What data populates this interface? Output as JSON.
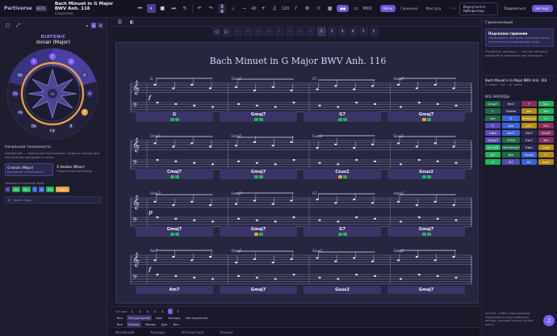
{
  "app": {
    "brand": "Partiverse",
    "brand_tag": "BETA",
    "title": "Bach Minuet in G Major BWV Anh. 116",
    "subtitle": "Сохранено"
  },
  "transport": {
    "tempo_top": "3",
    "tempo_bottom": "4",
    "bpm": "120",
    "metronome_value": "40",
    "mode_label": "MIDI"
  },
  "header_tabs": [
    "Ноты",
    "Гармония",
    "Фактура"
  ],
  "header_right": {
    "library": "Вернуться в библиотеку",
    "share": "Поделиться",
    "export": "Экспорт"
  },
  "left": {
    "diatonic_label": "DIATONIC",
    "mode_name": "Ionian (Major)",
    "circle_notes": [
      "C",
      "G",
      "D",
      "A",
      "E",
      "B",
      "F#",
      "Db",
      "Ab",
      "Eb",
      "Bb",
      "F"
    ],
    "mini": [
      "a",
      "b",
      "B"
    ],
    "section_title": "Начальная тональность",
    "hint": "Ионийский — самый светлый вариант ладов и основа для построения аккордов в песне.",
    "opt1_t": "G Ionian (Major)",
    "opt1_s": "Исходная тональность",
    "opt2_t": "E Aeolian (Minor)",
    "opt2_s": "Параллельный минор",
    "chords_label": "Аккорды ступеней лада",
    "scale_chips": [
      "G",
      "Am",
      "Bm",
      "C",
      "D",
      "Em",
      "F#dim"
    ],
    "search_ph": "Поиск ладу..."
  },
  "toolbar": {
    "items": [
      "1",
      "2",
      "3",
      "4"
    ],
    "pages": [
      "1",
      "2"
    ]
  },
  "score": {
    "title": "Bach Minuet in G Major BWV Anh. 116",
    "systems": [
      {
        "chords_above": [
          "G",
          "Gmaj7",
          "G7",
          "Gmaj7"
        ],
        "dyn": "f",
        "blocks": [
          "G",
          "Gmaj7",
          "G7",
          "Gmaj7"
        ]
      },
      {
        "chords_above": [
          "Cmaj7",
          "Gmaj7",
          "Csus2",
          "Gsus2"
        ],
        "dyn": "",
        "blocks": [
          "Cmaj7",
          "Gmaj7",
          "Csus2",
          "Gsus2"
        ]
      },
      {
        "chords_above": [
          "Gmaj7",
          "Gmaj7",
          "G7",
          "Gmaj7"
        ],
        "dyn": "p",
        "blocks": [
          "Gmaj7",
          "Gmaj7",
          "G7",
          "Gmaj7"
        ]
      },
      {
        "chords_above": [
          "Am7",
          "Gmaj7",
          "Gsus2",
          "Gmaj7"
        ],
        "dyn": "f",
        "blocks": [
          "Am7",
          "Gmaj7",
          "Gsus2",
          "Gmaj7"
        ]
      }
    ]
  },
  "bottom": {
    "row1_label": "Октава",
    "row1": [
      "1",
      "2",
      "3",
      "4",
      "5",
      "6",
      "7"
    ],
    "row2": [
      "Все",
      "Натуральный",
      "Шаг",
      "Аккорд",
      "Инструменты"
    ],
    "row3": [
      "Все",
      "Мажор",
      "Минор",
      "Доп",
      "Все"
    ],
    "row4_label": "Аккорды в:",
    "row4": [
      "G",
      "Ki",
      "Cc"
    ],
    "status": [
      "Ионийский",
      "Аккорды",
      "Аппликатура",
      "Хорошо"
    ]
  },
  "right": {
    "section1": "Гармонизация",
    "card_title": "Подсказка гармонии",
    "card_text": "Подбирайте аккорды, которые звучат естественно в выбранном ладу.",
    "note1": "Подобные аккорды — частые находки",
    "note2": "выбирайте гармонию под мелодию",
    "piece_title": "Bach Minuet in G Major BWV Anh. 116",
    "piece_sub": "G major · 3/4 · 32 такта",
    "chords_header": "ВСЕ АККОРДЫ",
    "chord_chips": [
      "Gmaj7",
      "Em7",
      "F",
      "Dm",
      "C",
      "F#dim",
      "Bm",
      "Em",
      "Am",
      "G",
      "Bm9sus2",
      "C7",
      "E",
      "Am",
      "Am7",
      "Dm",
      "C#m",
      "Am7",
      "Gm7",
      "Fmaj7",
      "Gmaj7",
      "G7b5",
      "Em7",
      "Bm",
      "Gm7b5",
      "Gdim9maj7",
      "Ebm",
      "Cdim",
      "D7",
      "Bm",
      "Fmaj7",
      "F7",
      "G",
      "D7",
      "A7",
      "Am9"
    ],
    "help": "Хотите, чтобы подсказывали гармонию по ладу выберите аккорд, который звучит лучше всего"
  },
  "colors": {
    "accent": "#7c5cff",
    "green": "#22b35b",
    "yellow": "#f0b000",
    "pink": "#e0408a",
    "blue": "#3c63d6"
  }
}
